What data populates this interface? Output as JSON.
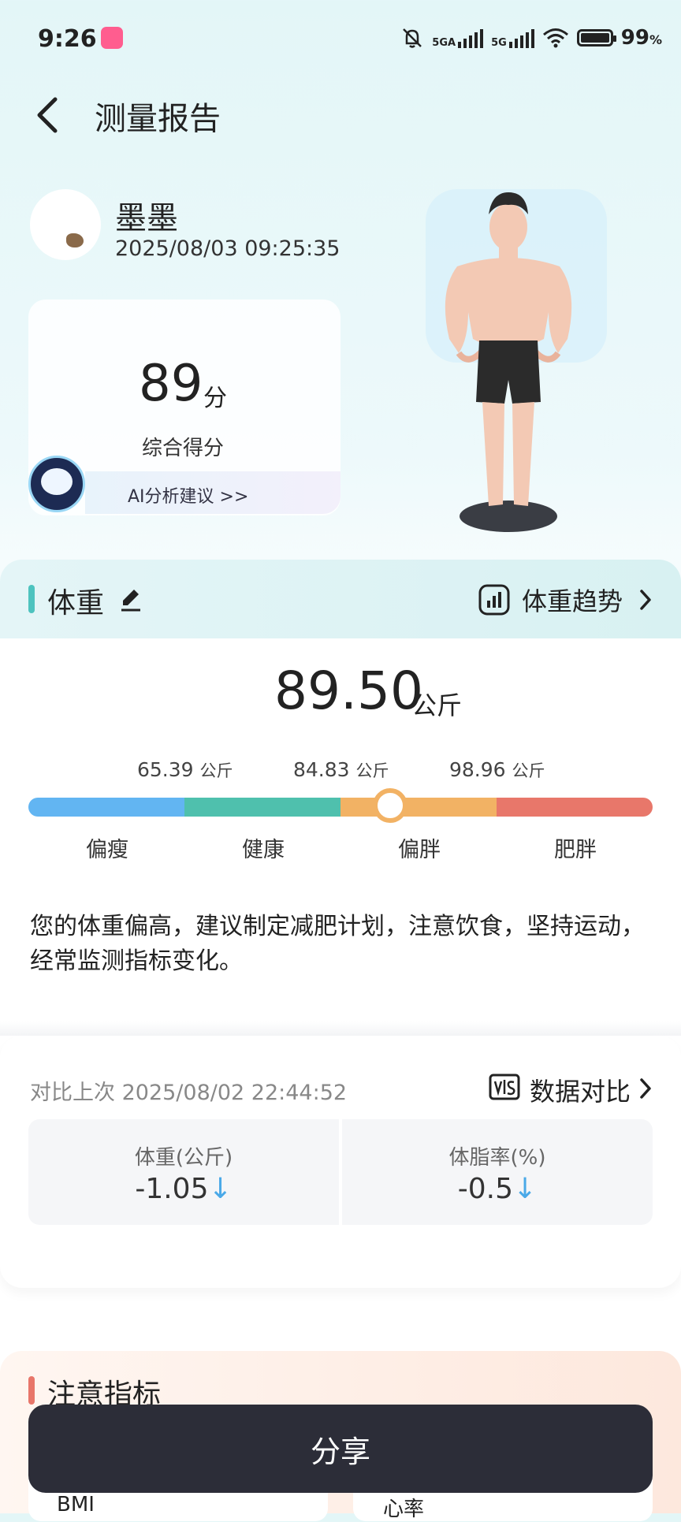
{
  "status_bar": {
    "time": "9:26",
    "net1": "5GA",
    "net2": "5G",
    "battery": "99",
    "battery_unit": "%"
  },
  "header": {
    "title": "测量报告"
  },
  "user": {
    "name": "墨墨",
    "datetime": "2025/08/03 09:25:35"
  },
  "score": {
    "value": "89",
    "unit": "分",
    "label": "综合得分",
    "ai_link": "AI分析建议  >>"
  },
  "weight": {
    "section_title": "体重",
    "trend_label": "体重趋势",
    "value": "89.50",
    "unit": "公斤",
    "thresholds": [
      {
        "value": "65.39",
        "unit": "公斤"
      },
      {
        "value": "84.83",
        "unit": "公斤"
      },
      {
        "value": "98.96",
        "unit": "公斤"
      }
    ],
    "segments": [
      {
        "label": "偏瘦",
        "color": "#62b5f2"
      },
      {
        "label": "健康",
        "color": "#4fc0ad"
      },
      {
        "label": "偏胖",
        "color": "#f2b264"
      },
      {
        "label": "肥胖",
        "color": "#e8776a"
      }
    ],
    "indicator_fraction": 0.58,
    "advice": "您的体重偏高，建议制定减肥计划，注意饮食，坚持运动，经常监测指标变化。"
  },
  "compare": {
    "date_text": "对比上次 2025/08/02 22:44:52",
    "link_label": "数据对比",
    "cells": [
      {
        "label": "体重(公斤)",
        "value": "-1.05",
        "arrow": "↓"
      },
      {
        "label": "体脂率(%)",
        "value": "-0.5",
        "arrow": "↓"
      }
    ]
  },
  "attention": {
    "title": "注意指标",
    "items": [
      "BMI",
      "心率"
    ]
  },
  "share_button": "分享",
  "colors": {
    "accent_teal": "#4dc3bf",
    "accent_red": "#e8766a",
    "share_bg": "#2c2d38",
    "down_arrow": "#4aa9e8"
  }
}
